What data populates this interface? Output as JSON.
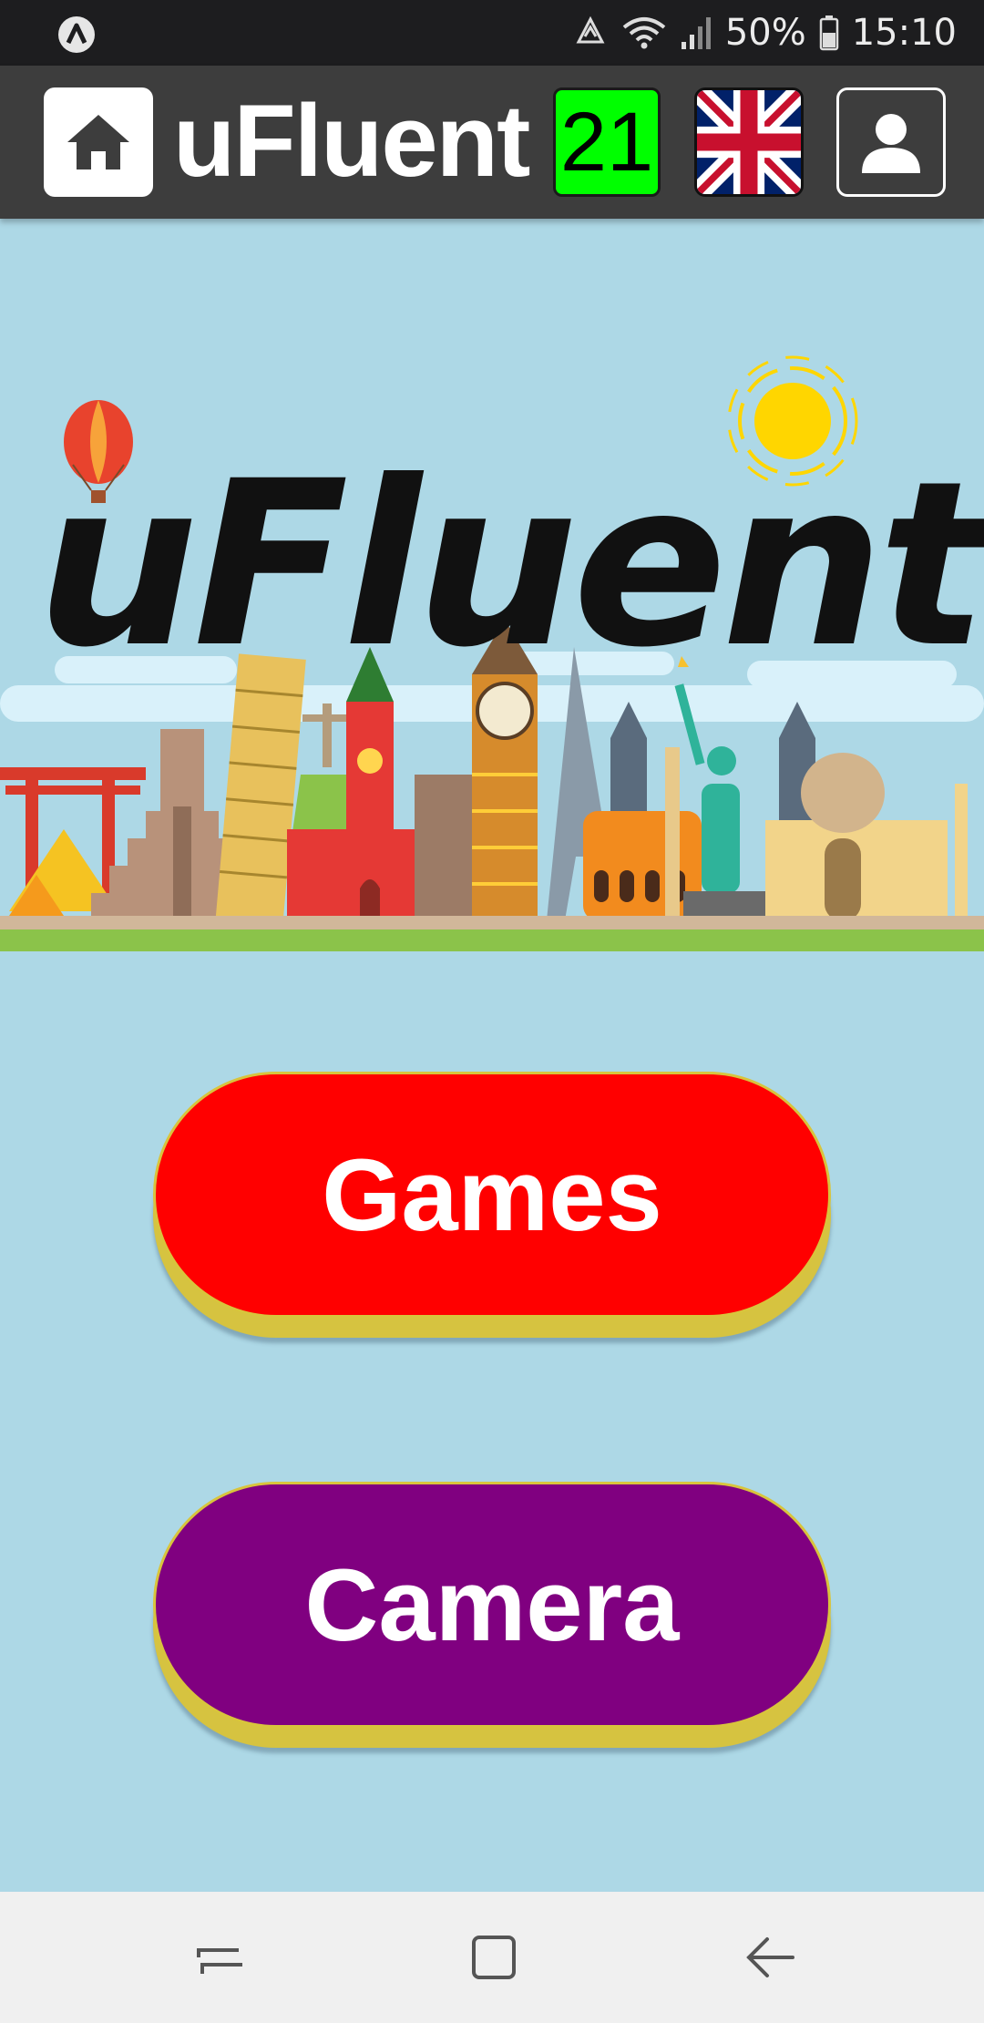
{
  "status_bar": {
    "battery": "50%",
    "time": "15:10",
    "icons": [
      "app-notification-icon",
      "data-saver-icon",
      "wifi-icon",
      "signal-icon",
      "battery-icon"
    ]
  },
  "header": {
    "title": "uFluent",
    "streak_count": "21",
    "language_flag": "uk-flag-icon",
    "icons": [
      "home-icon",
      "user-icon"
    ]
  },
  "banner": {
    "title": "uFluent",
    "illustration": "world-landmarks-illustration"
  },
  "main": {
    "games_label": "Games",
    "camera_label": "Camera"
  },
  "nav_bar": {
    "icons": [
      "recent-apps-icon",
      "home-nav-icon",
      "back-icon"
    ]
  },
  "colors": {
    "background": "#add8e6",
    "header": "#3d3d3d",
    "streak_badge": "#00ff00",
    "games_button": "#ff0000",
    "camera_button": "#800080",
    "button_shadow": "#d6c340"
  }
}
